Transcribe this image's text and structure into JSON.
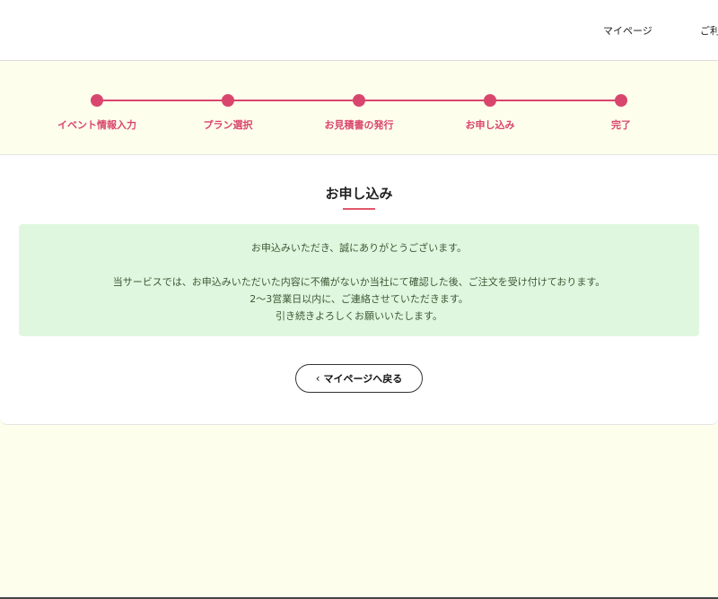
{
  "header": {
    "nav": [
      "マイページ",
      "ご利"
    ]
  },
  "steps": [
    {
      "label": "イベント情報入力"
    },
    {
      "label": "プラン選択"
    },
    {
      "label": "お見積書の発行"
    },
    {
      "label": "お申し込み"
    },
    {
      "label": "完了"
    }
  ],
  "main": {
    "title": "お申し込み",
    "message": {
      "line1": "お申込みいただき、誠にありがとうございます。",
      "line2": "当サービスでは、お申込みいただいた内容に不備がないか当社にて確認した後、ご注文を受け付けております。",
      "line3": "2〜3営業日以内に、ご連絡させていただきます。",
      "line4": "引き続きよろしくお願いいたします。"
    },
    "back_button": {
      "chevron": "‹",
      "label": "マイページへ戻る"
    }
  },
  "colors": {
    "accent": "#d9466d",
    "background": "#fefeed",
    "message_bg": "#dff7df",
    "message_text": "#3c5a35"
  }
}
